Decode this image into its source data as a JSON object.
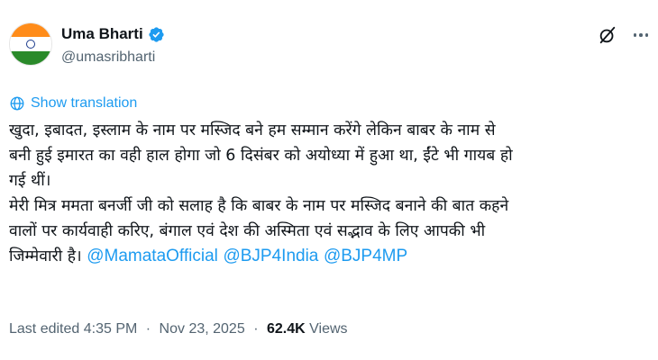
{
  "author": {
    "display_name": "Uma Bharti",
    "handle": "@umasribharti"
  },
  "translate": {
    "label": "Show translation"
  },
  "tweet": {
    "lines": [
      "खुदा, इबादत, इस्लाम के नाम पर मस्जिद बने हम सम्मान करेंगे लेकिन बाबर के नाम से",
      "बनी हुई इमारत का वही हाल होगा जो 6 दिसंबर को अयोध्या में हुआ था, ईंटे भी गायब हो",
      "गई थीं।",
      "मेरी मित्र ममता बनर्जी जी को सलाह है कि बाबर के नाम पर मस्जिद बनाने की बात कहने",
      "वालों पर कार्यवाही करिए, बंगाल एवं देश की अस्मिता एवं सद्भाव के लिए आपकी भी"
    ],
    "last_line_text": "जिम्मेवारी है।",
    "mentions": [
      "@MamataOfficial",
      "@BJP4India",
      "@BJP4MP"
    ]
  },
  "meta": {
    "edited_label": "Last edited 4:35 PM",
    "date": "Nov 23, 2025",
    "views_count": "62.4K",
    "views_label": "Views",
    "separator": "·"
  },
  "colors": {
    "accent": "#1d9bf0",
    "text": "#0f1419",
    "muted": "#536471"
  }
}
